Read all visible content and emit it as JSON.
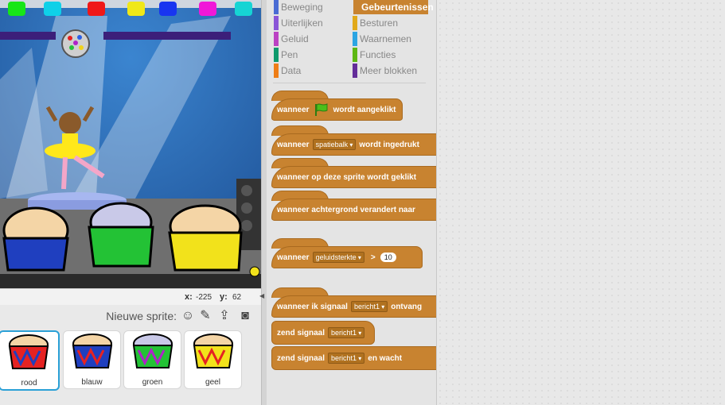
{
  "coords": {
    "x_label": "x:",
    "x_value": "-225",
    "y_label": "y:",
    "y_value": "62"
  },
  "sprite_pane": {
    "new_sprite_label": "Nieuwe sprite:",
    "sprites": [
      {
        "name": "rood",
        "color": "#e52222"
      },
      {
        "name": "blauw",
        "color": "#1f3fbf"
      },
      {
        "name": "groen",
        "color": "#23c235"
      },
      {
        "name": "geel",
        "color": "#f2e21b"
      }
    ]
  },
  "categories": {
    "left": [
      {
        "label": "Beweging",
        "color": "#4a6cd4"
      },
      {
        "label": "Uiterlijken",
        "color": "#8a55d7"
      },
      {
        "label": "Geluid",
        "color": "#bb42c3"
      },
      {
        "label": "Pen",
        "color": "#0e9a6c"
      },
      {
        "label": "Data",
        "color": "#ee7d16"
      }
    ],
    "right": [
      {
        "label": "Gebeurtenissen",
        "color": "#c88330"
      },
      {
        "label": "Besturen",
        "color": "#e1a91a"
      },
      {
        "label": "Waarnemen",
        "color": "#2ca5e2"
      },
      {
        "label": "Functies",
        "color": "#5cb712"
      },
      {
        "label": "Meer blokken",
        "color": "#632d99"
      }
    ]
  },
  "blocks": {
    "flag": {
      "pre": "wanneer",
      "post": "wordt aangeklikt"
    },
    "key": {
      "pre": "wanneer",
      "dropdown": "spatiebalk",
      "post": "wordt ingedrukt"
    },
    "sprite_click": {
      "text": "wanneer op deze sprite wordt geklikt"
    },
    "backdrop": {
      "text": "wanneer achtergrond verandert naar"
    },
    "loudness": {
      "pre": "wanneer",
      "dropdown": "geluidsterkte",
      "op": ">",
      "value": "10"
    },
    "receive": {
      "pre": "wanneer ik signaal",
      "dropdown": "bericht1",
      "post": "ontvang"
    },
    "broadcast": {
      "pre": "zend signaal",
      "dropdown": "bericht1"
    },
    "broadcast_wait": {
      "pre": "zend signaal",
      "dropdown": "bericht1",
      "post": "en wacht"
    }
  }
}
